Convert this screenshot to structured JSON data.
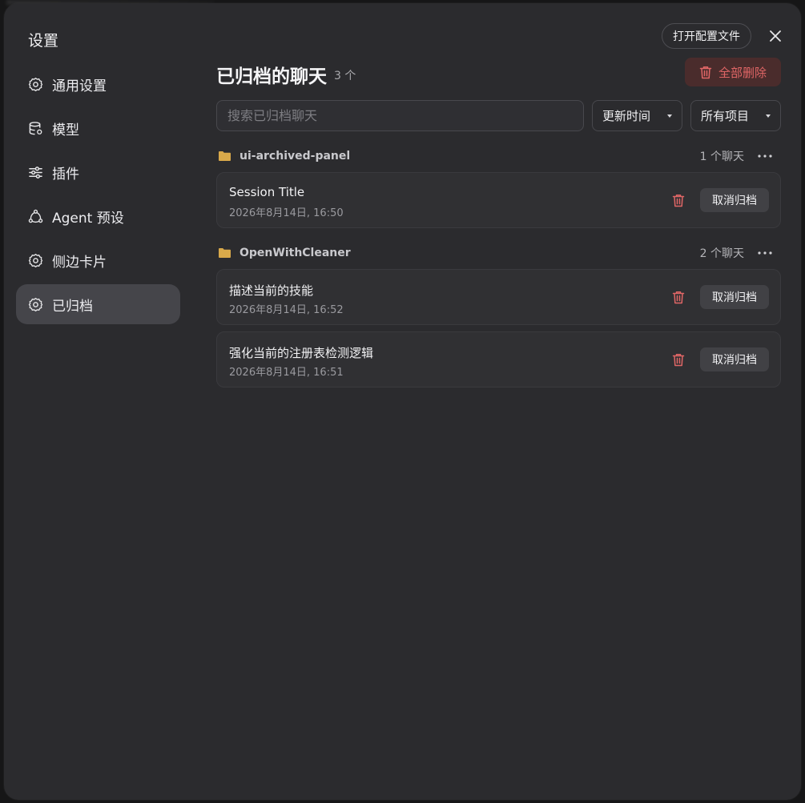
{
  "dialog": {
    "title": "设置",
    "open_config_label": "打开配置文件"
  },
  "sidebar": {
    "items": [
      {
        "label": "通用设置",
        "icon": "gear-icon"
      },
      {
        "label": "模型",
        "icon": "database-gear-icon"
      },
      {
        "label": "插件",
        "icon": "sliders-icon"
      },
      {
        "label": "Agent 预设",
        "icon": "agent-nodes-icon"
      },
      {
        "label": "侧边卡片",
        "icon": "gear-icon"
      },
      {
        "label": "已归档",
        "icon": "gear-icon",
        "active": true
      }
    ]
  },
  "main": {
    "title": "已归档的聊天",
    "count": "3 个",
    "delete_all_label": "全部删除",
    "search": {
      "placeholder": "搜索已归档聊天",
      "value": ""
    },
    "sort": {
      "selected": "更新时间"
    },
    "project_filter": {
      "selected": "所有项目"
    },
    "groups": [
      {
        "name": "ui-archived-panel",
        "count": "1 个聊天",
        "chats": [
          {
            "title": "Session Title",
            "time": "2026年8月14日, 16:50",
            "unarchive_label": "取消归档"
          }
        ]
      },
      {
        "name": "OpenWithCleaner",
        "count": "2 个聊天",
        "chats": [
          {
            "title": "描述当前的技能",
            "time": "2026年8月14日, 16:52",
            "unarchive_label": "取消归档"
          },
          {
            "title": "强化当前的注册表检测逻辑",
            "time": "2026年8月14日, 16:51",
            "unarchive_label": "取消归档"
          }
        ]
      }
    ]
  },
  "colors": {
    "dialog_bg": "#2b2b2e",
    "active_nav_bg": "#45454a",
    "danger": "#e06666",
    "folder": "#d9a94a"
  }
}
